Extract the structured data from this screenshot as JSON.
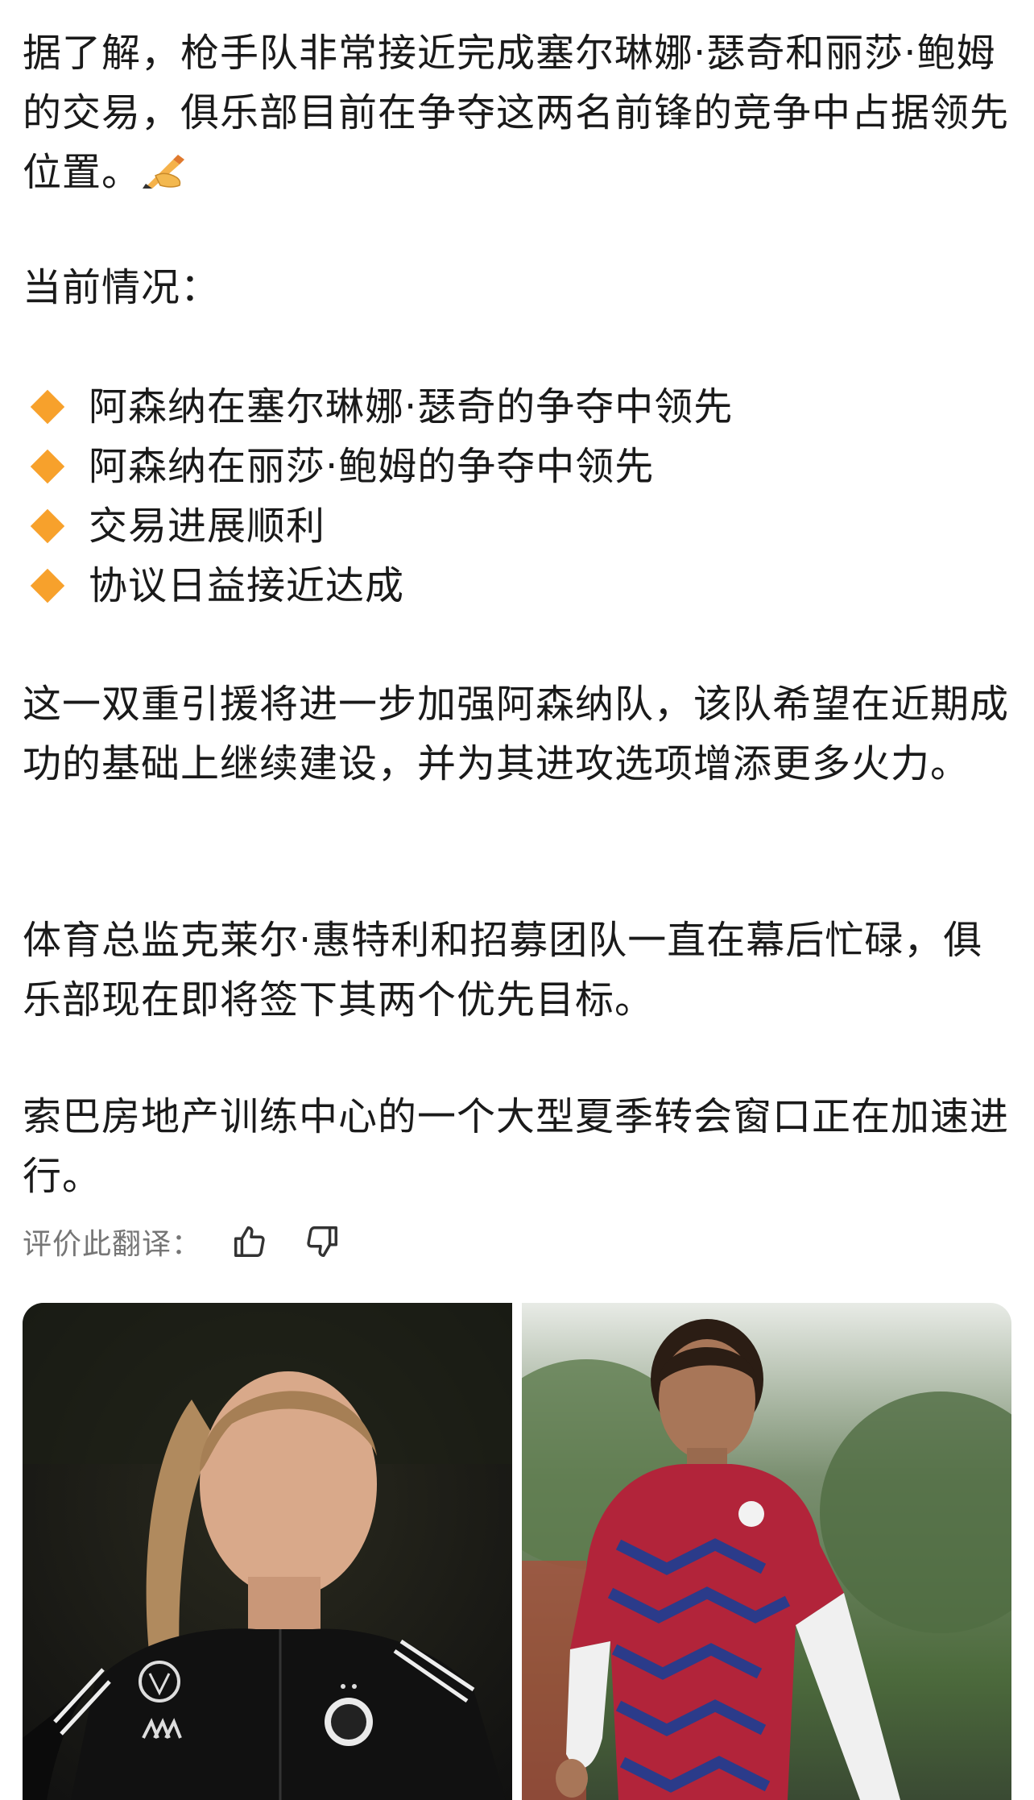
{
  "article": {
    "para1": "据了解，枪手队非常接近完成塞尔琳娜·瑟奇和丽莎·鲍姆的交易，俱乐部目前在争夺这两名前锋的竞争中占据领先位置。",
    "para1_emoji": "writing-hand-emoji",
    "para2": "当前情况：",
    "bullets": [
      "阿森纳在塞尔琳娜·瑟奇的争夺中领先",
      "阿森纳在丽莎·鲍姆的争夺中领先",
      "交易进展顺利",
      "协议日益接近达成"
    ],
    "bullet_icon": "orange-diamond-icon",
    "bullet_color": "#f7a12c",
    "para3": "这一双重引援将进一步加强阿森纳队，该队希望在近期成功的基础上继续建设，并为其进攻选项增添更多火力。",
    "para4": "体育总监克莱尔·惠特利和招募团队一直在幕后忙碌，俱乐部现在即将签下其两个优先目标。",
    "para5": "索巴房地产训练中心的一个大型夏季转会窗口正在加速进行。"
  },
  "rating": {
    "label": "评价此翻译：",
    "thumbs_up_icon": "thumbs-up-icon",
    "thumbs_down_icon": "thumbs-down-icon"
  },
  "photos": {
    "left": "player-photo-germany-kit",
    "right": "player-photo-leipzig-kit"
  },
  "colors": {
    "text": "#1a1a1a",
    "muted": "#767676",
    "accent": "#f7a12c"
  }
}
